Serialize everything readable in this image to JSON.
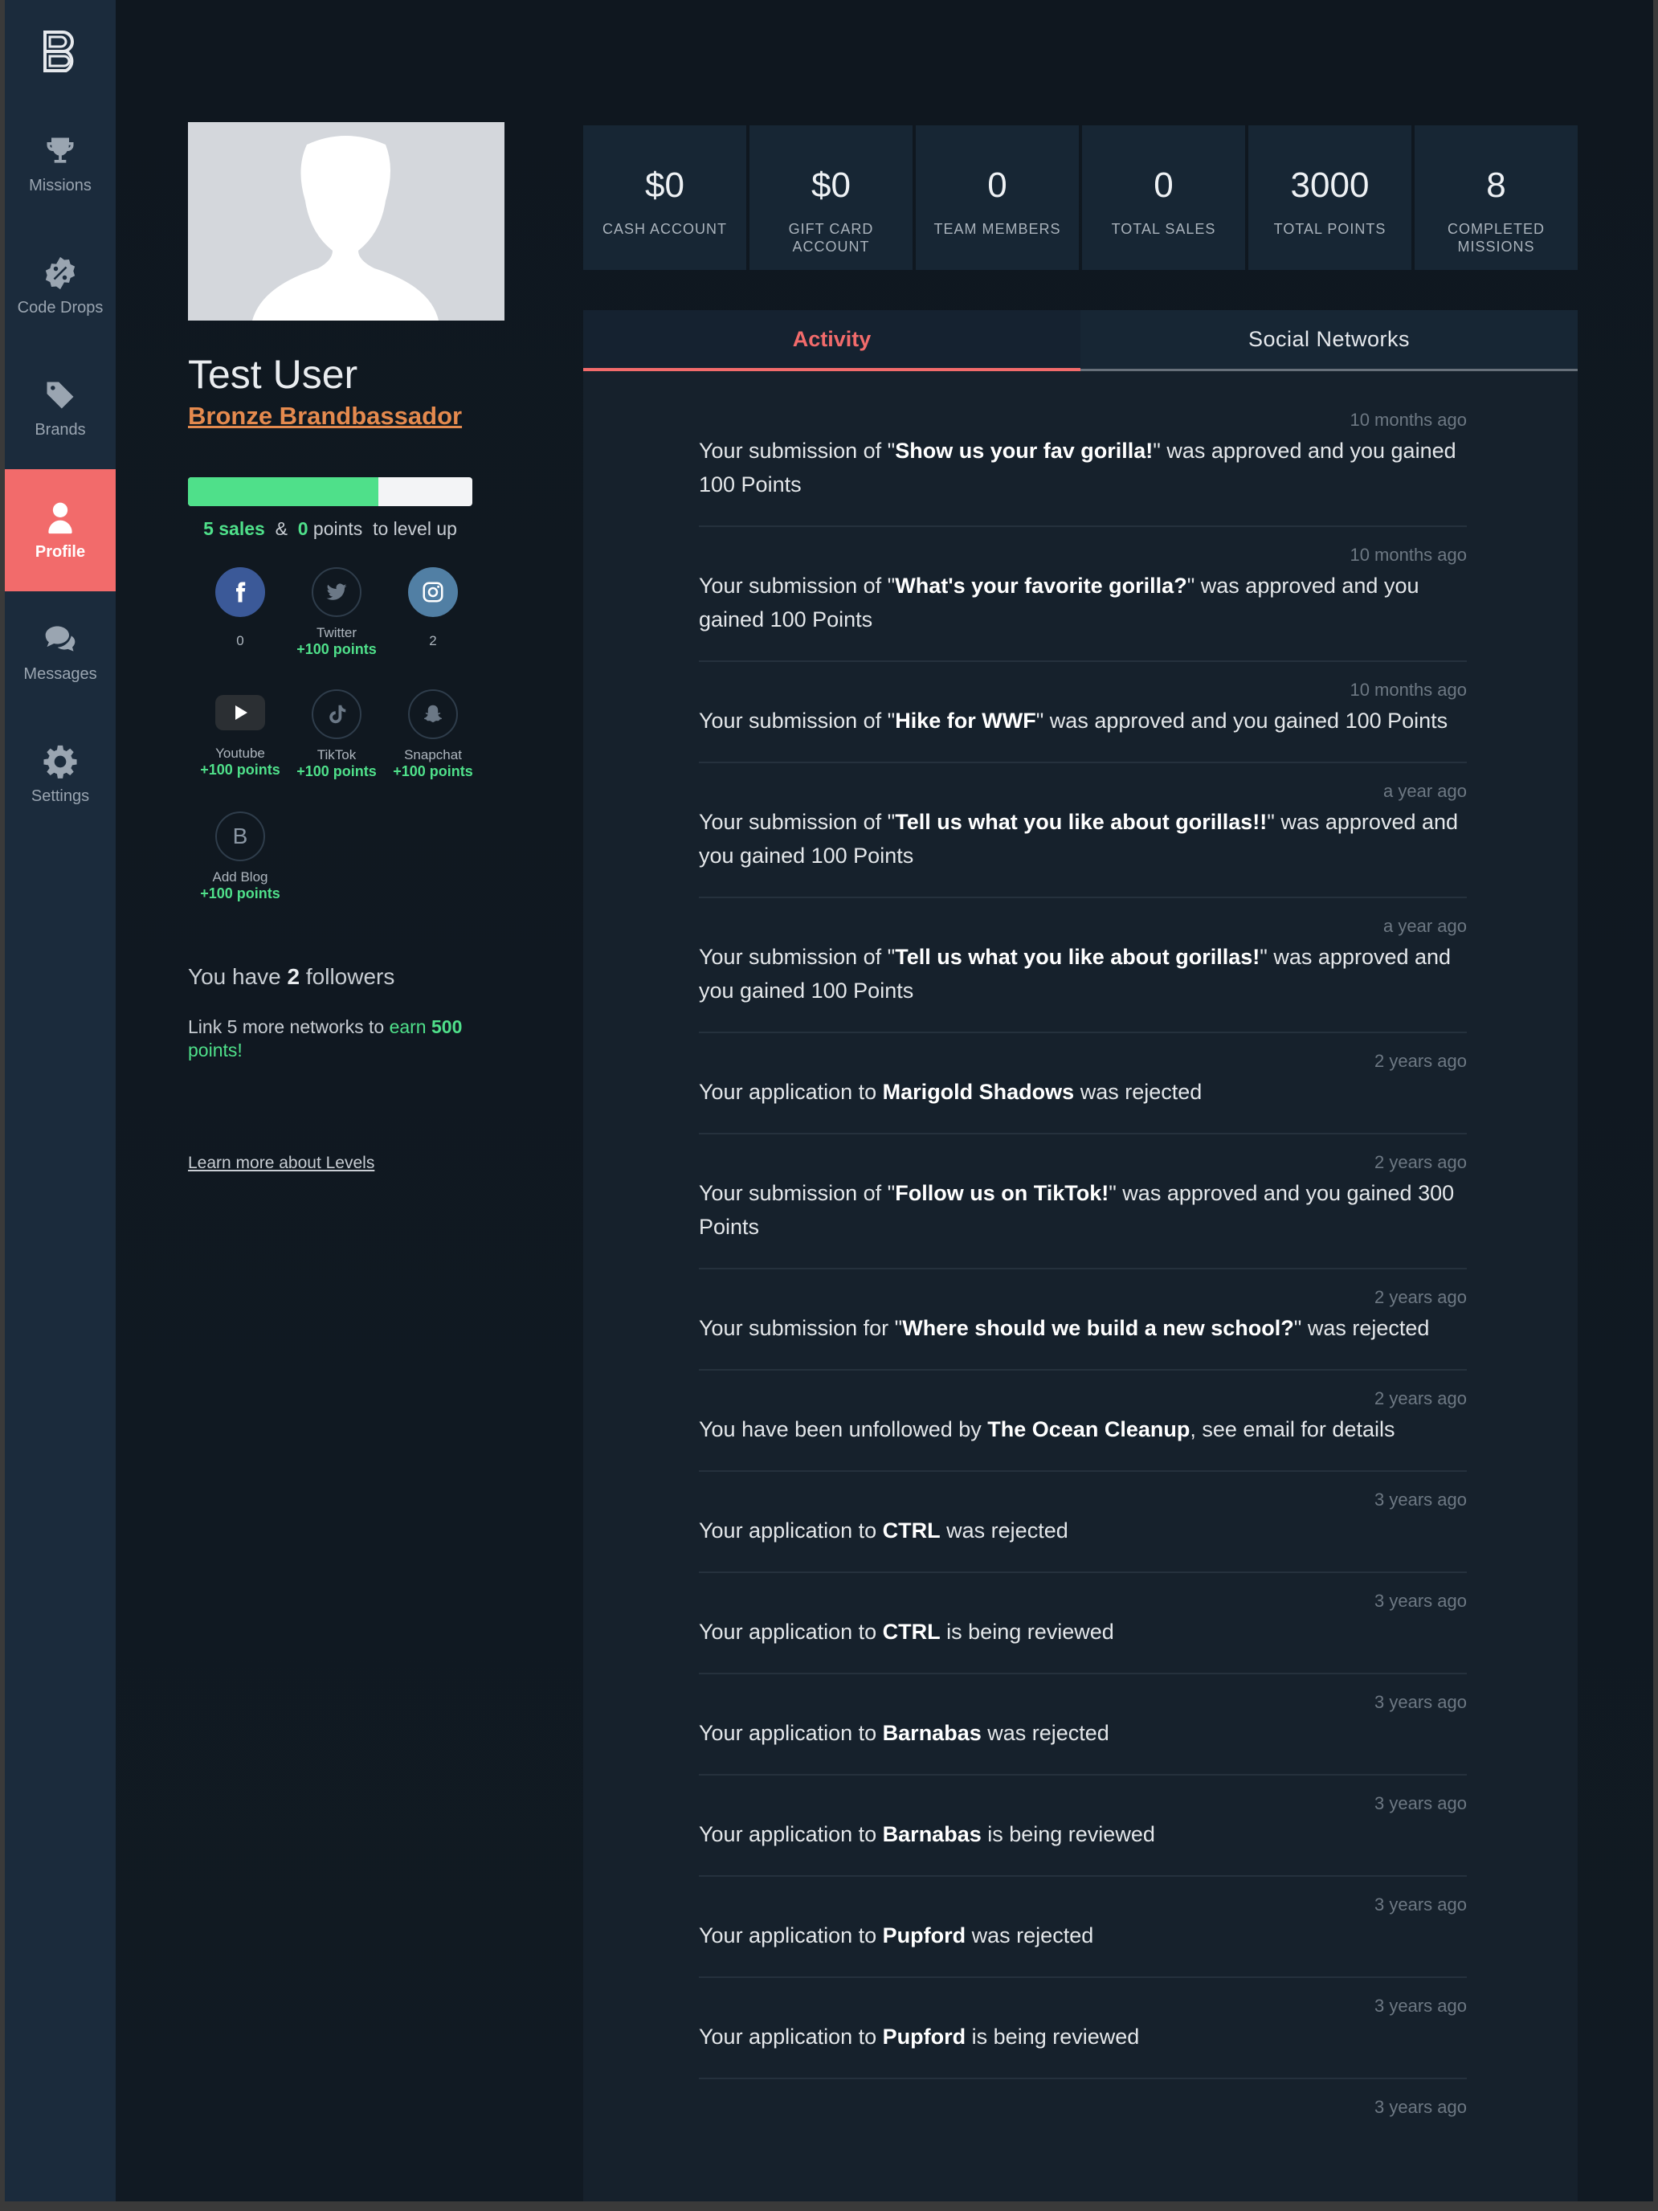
{
  "sidebar": {
    "logo_icon": "brandbassador-logo-icon",
    "items": [
      {
        "label": "Missions",
        "icon": "trophy-icon",
        "active": false
      },
      {
        "label": "Code Drops",
        "icon": "percent-badge-icon",
        "active": false
      },
      {
        "label": "Brands",
        "icon": "tags-icon",
        "active": false
      },
      {
        "label": "Profile",
        "icon": "user-icon",
        "active": true
      },
      {
        "label": "Messages",
        "icon": "chat-bubbles-icon",
        "active": false
      },
      {
        "label": "Settings",
        "icon": "gear-icon",
        "active": false
      }
    ]
  },
  "profile": {
    "name": "Test User",
    "level": "Bronze Brandbassador",
    "progress_fraction": 0.67,
    "levelup": {
      "sales_value": "5",
      "sales_word": "sales",
      "amp": "&",
      "points_value": "0",
      "points_word": "points",
      "suffix": "to level up"
    },
    "networks": [
      {
        "label": "",
        "value": "0",
        "icon": "facebook-icon",
        "color": "#3b5998"
      },
      {
        "label": "Twitter",
        "value": "+100 points",
        "icon": "twitter-icon"
      },
      {
        "label": "",
        "value": "2",
        "icon": "instagram-icon",
        "color": "#517fa4"
      },
      {
        "label": "Youtube",
        "value": "+100 points",
        "icon": "youtube-icon"
      },
      {
        "label": "TikTok",
        "value": "+100 points",
        "icon": "tiktok-icon"
      },
      {
        "label": "Snapchat",
        "value": "+100 points",
        "icon": "snapchat-icon"
      },
      {
        "label": "Add Blog",
        "value": "+100 points",
        "icon": "blog-icon",
        "glyph": "B"
      }
    ],
    "followers": {
      "prefix": "You have",
      "count": "2",
      "suffix": "followers"
    },
    "link_more": {
      "text": "Link 5 more networks to",
      "earn": "earn",
      "amount": "500",
      "points": "points!"
    },
    "learn_more": "Learn more about Levels"
  },
  "stats": [
    {
      "value": "$0",
      "label": "CASH ACCOUNT"
    },
    {
      "value": "$0",
      "label": "GIFT CARD ACCOUNT"
    },
    {
      "value": "0",
      "label": "TEAM MEMBERS"
    },
    {
      "value": "0",
      "label": "TOTAL SALES"
    },
    {
      "value": "3000",
      "label": "TOTAL POINTS"
    },
    {
      "value": "8",
      "label": "COMPLETED MISSIONS"
    }
  ],
  "tabs": {
    "activity": "Activity",
    "social": "Social Networks"
  },
  "activity": [
    {
      "time": "10 months ago",
      "pre": "Your submission of \"",
      "bold": "Show us your fav gorilla!",
      "post": "\" was approved and you gained 100 Points"
    },
    {
      "time": "10 months ago",
      "pre": "Your submission of \"",
      "bold": "What's your favorite gorilla?",
      "post": "\" was approved and you gained 100 Points"
    },
    {
      "time": "10 months ago",
      "pre": "Your submission of \"",
      "bold": "Hike for WWF",
      "post": "\" was approved and you gained 100 Points"
    },
    {
      "time": "a year ago",
      "pre": "Your submission of \"",
      "bold": "Tell us what you like about gorillas!!",
      "post": "\" was approved and you gained 100 Points"
    },
    {
      "time": "a year ago",
      "pre": "Your submission of \"",
      "bold": "Tell us what you like about gorillas!",
      "post": "\" was approved and you gained 100 Points"
    },
    {
      "time": "2 years ago",
      "pre": "Your application to ",
      "bold": "Marigold Shadows",
      "post": " was rejected"
    },
    {
      "time": "2 years ago",
      "pre": "Your submission of \"",
      "bold": "Follow us on TikTok!",
      "post": "\" was approved and you gained 300 Points"
    },
    {
      "time": "2 years ago",
      "pre": "Your submission for \"",
      "bold": "Where should we build a new school?",
      "post": "\" was rejected"
    },
    {
      "time": "2 years ago",
      "pre": "You have been unfollowed by ",
      "bold": "The Ocean Cleanup",
      "post": ", see email for details"
    },
    {
      "time": "3 years ago",
      "pre": "Your application to ",
      "bold": "CTRL",
      "post": " was rejected"
    },
    {
      "time": "3 years ago",
      "pre": "Your application to ",
      "bold": "CTRL",
      "post": " is being reviewed"
    },
    {
      "time": "3 years ago",
      "pre": "Your application to ",
      "bold": "Barnabas",
      "post": " was rejected"
    },
    {
      "time": "3 years ago",
      "pre": "Your application to ",
      "bold": "Barnabas",
      "post": " is being reviewed"
    },
    {
      "time": "3 years ago",
      "pre": "Your application to ",
      "bold": "Pupford",
      "post": " was rejected"
    },
    {
      "time": "3 years ago",
      "pre": "Your application to ",
      "bold": "Pupford",
      "post": " is being reviewed"
    },
    {
      "time": "3 years ago",
      "pre": "",
      "bold": "",
      "post": ""
    }
  ],
  "colors": {
    "accent": "#f26b6b",
    "green": "#4fe08a",
    "level": "#e58a4e"
  }
}
